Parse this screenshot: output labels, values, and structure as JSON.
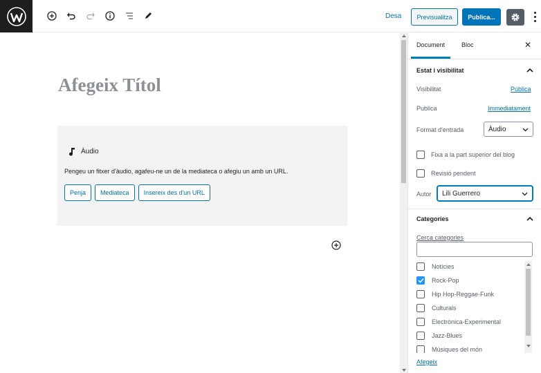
{
  "toolbar": {
    "draft_label": "Desa",
    "preview_label": "Previsualitza",
    "publish_label": "Publica..."
  },
  "editor": {
    "title_placeholder": "Afegeix Títol",
    "audio_block": {
      "label": "Àudio",
      "description": "Pengeu un fitxer d'àudio, agafeu-ne un de la mediateca o afegiu un amb un URL.",
      "buttons": [
        "Penja",
        "Mediateca",
        "Insereix des d'un URL"
      ]
    }
  },
  "sidebar": {
    "tabs": [
      "Document",
      "Bloc"
    ],
    "active_tab": "Document",
    "status_panel": {
      "title": "Estat i visibilitat",
      "visibility_label": "Visibilitat",
      "visibility_value": "Pública",
      "publish_label": "Publica",
      "publish_value": "Immediatament",
      "format_label": "Format d'entrada",
      "format_value": "Àudio",
      "sticky_label": "Fixa a la part superior del blog",
      "pending_label": "Revisió pendent",
      "author_label": "Autor",
      "author_value": "Lili Guerrero"
    },
    "categories_panel": {
      "title": "Categories",
      "search_label": "Cerca categories",
      "items": [
        {
          "label": "Notícies",
          "checked": false
        },
        {
          "label": "Rock-Pop",
          "checked": true
        },
        {
          "label": "Hip Hop-Reggae-Funk",
          "checked": false
        },
        {
          "label": "Culturals",
          "checked": false
        },
        {
          "label": "Electrònica-Experimental",
          "checked": false
        },
        {
          "label": "Jazz-Blues",
          "checked": false
        },
        {
          "label": "Músiques del món",
          "checked": false
        }
      ],
      "add_new_label": "Afegeix"
    }
  },
  "colors": {
    "accent": "#0073aa",
    "publish_bg": "#0074b8",
    "checkbox_checked": "#2196f3"
  }
}
